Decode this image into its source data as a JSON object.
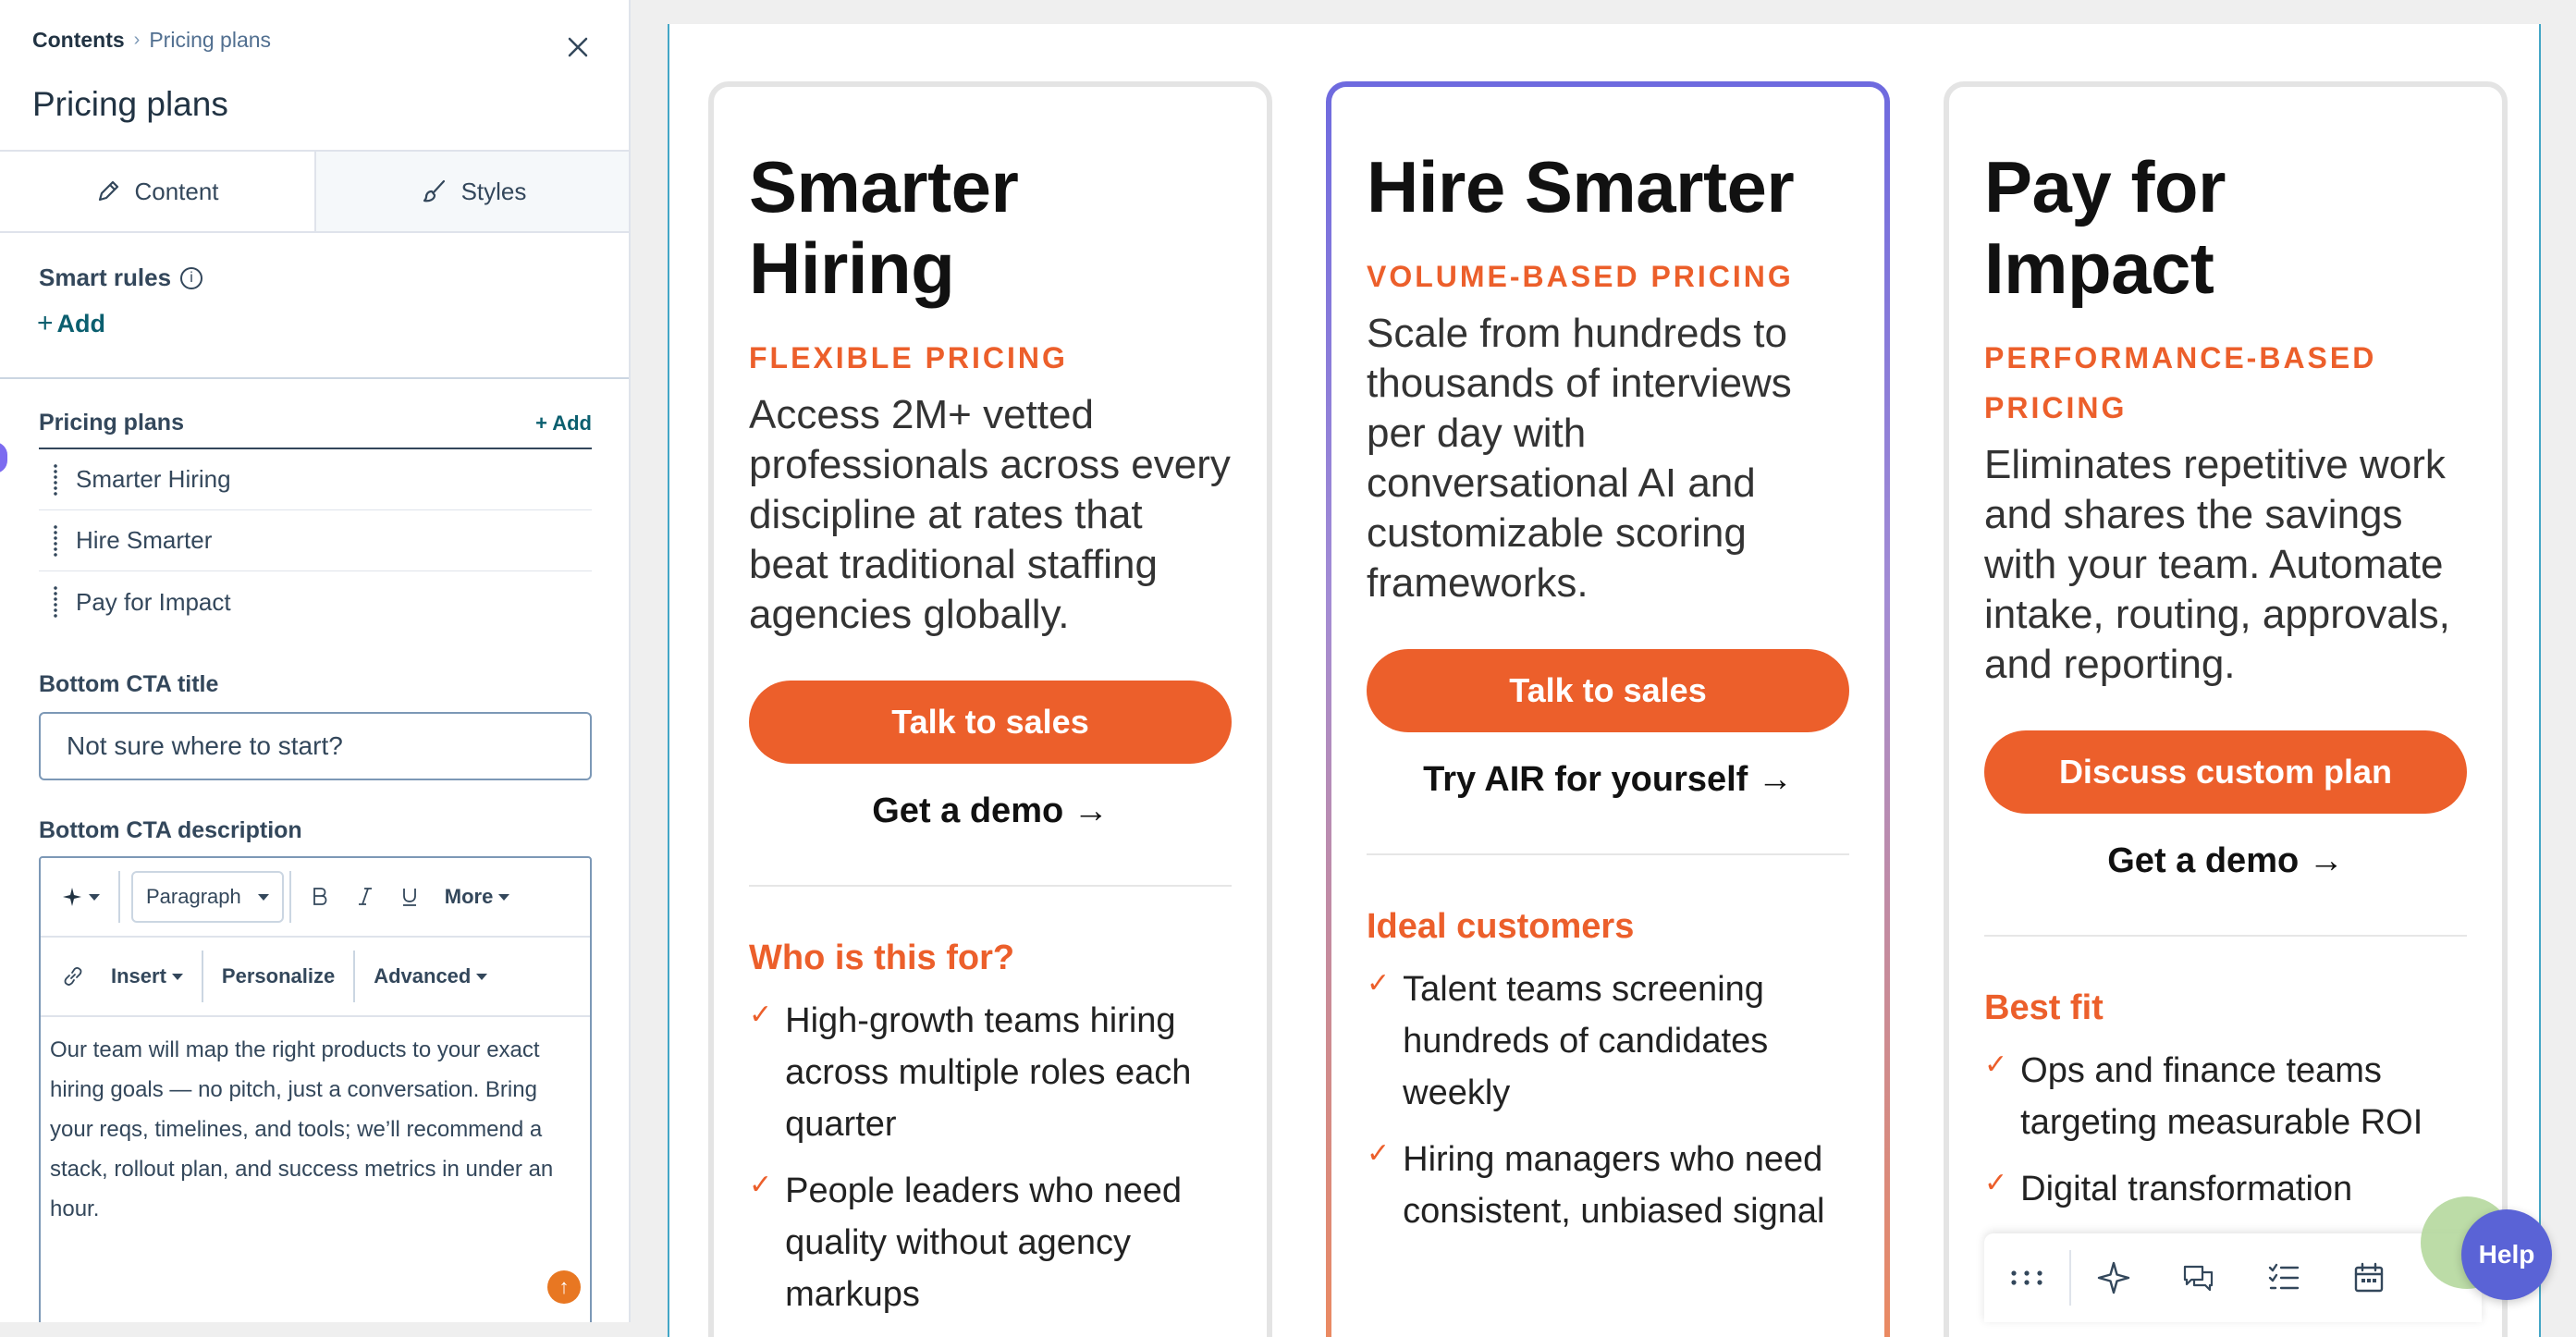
{
  "sidebar": {
    "breadcrumb": {
      "root": "Contents",
      "current": "Pricing plans"
    },
    "title": "Pricing plans",
    "tabs": [
      {
        "label": "Content",
        "icon": "pencil-icon",
        "active": true
      },
      {
        "label": "Styles",
        "icon": "brush-icon",
        "active": false
      }
    ],
    "smart_rules": {
      "label": "Smart rules",
      "add_label": "Add"
    },
    "pricing_plans": {
      "label": "Pricing plans",
      "add_label": "+ Add",
      "items": [
        "Smarter Hiring",
        "Hire Smarter",
        "Pay for Impact"
      ]
    },
    "bottom_cta_title": {
      "label": "Bottom CTA title",
      "value": "Not sure where to start?"
    },
    "bottom_cta_description": {
      "label": "Bottom CTA description",
      "toolbar": {
        "format_select": "Paragraph",
        "more_label": "More",
        "insert_label": "Insert",
        "personalize_label": "Personalize",
        "advanced_label": "Advanced"
      },
      "value": "Our team will map the right products to your exact hiring goals — no pitch, just a conversation. Bring your reqs, timelines, and tools; we’ll recommend a stack, rollout plan, and success metrics in under an hour."
    }
  },
  "cards": [
    {
      "title": "Smarter Hiring",
      "eyebrow": "FLEXIBLE PRICING",
      "description": "Access 2M+ vetted professionals across every discipline at rates that beat traditional staffing agencies globally.",
      "cta": "Talk to sales",
      "link": "Get a demo →",
      "section_title": "Who is this for?",
      "bullets": [
        "High-growth teams hiring across multiple roles each quarter",
        "People leaders who need quality without agency markups"
      ]
    },
    {
      "title": "Hire Smarter",
      "eyebrow": "VOLUME-BASED PRICING",
      "description": "Scale from hundreds to thousands of interviews per day with conversational AI and customizable scoring frameworks.",
      "cta": "Talk to sales",
      "link": "Try AIR for yourself →",
      "section_title": "Ideal customers",
      "bullets": [
        "Talent teams screening hundreds of candidates weekly",
        "Hiring managers who need consistent, unbiased signal"
      ]
    },
    {
      "title": "Pay for Impact",
      "eyebrow": "PERFORMANCE-BASED PRICING",
      "description": "Eliminates repetitive work and shares the savings with your team. Automate intake, routing, approvals, and reporting.",
      "cta": "Discuss custom plan",
      "link": "Get a demo →",
      "section_title": "Best fit",
      "bullets": [
        "Ops and finance teams targeting measurable ROI",
        "Digital transformation"
      ]
    }
  ],
  "help_label": "Help",
  "colors": {
    "accent": "#ec5f2b",
    "link_teal": "#0b5f6f",
    "help": "#5a63d6",
    "featured_border_top": "#6e6adf"
  }
}
